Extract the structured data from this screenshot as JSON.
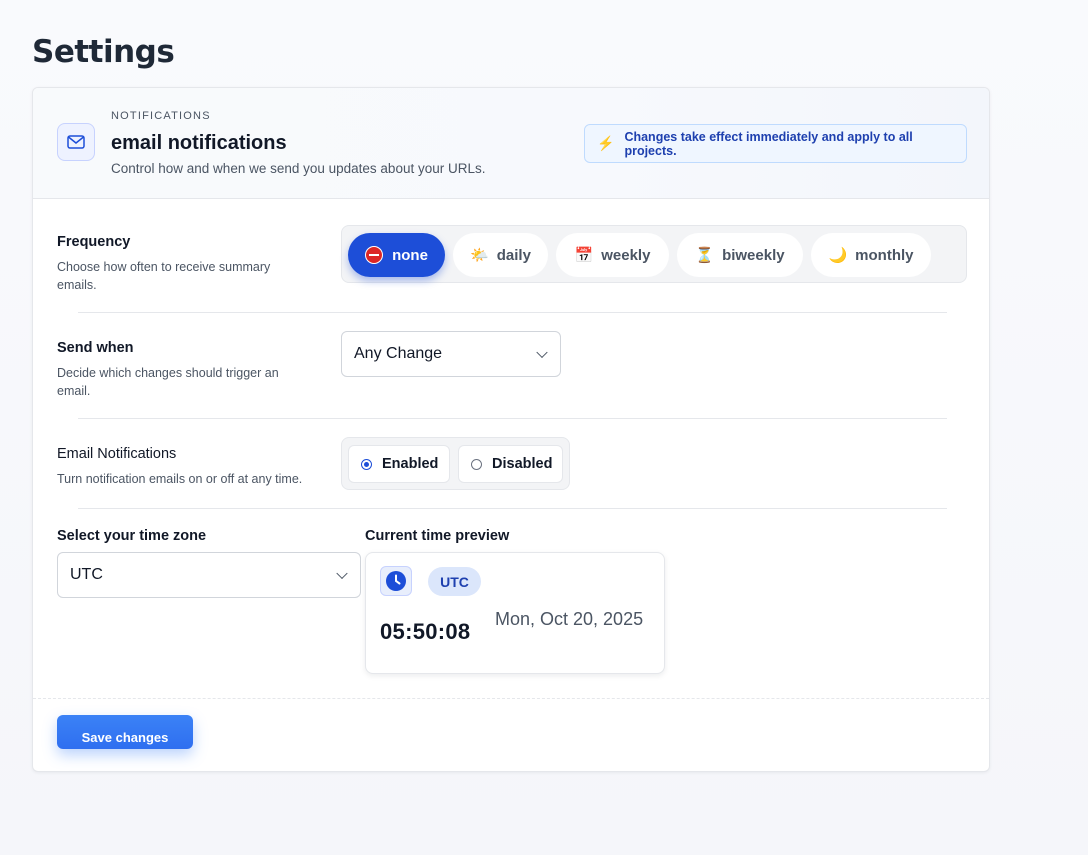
{
  "page": {
    "title": "Settings"
  },
  "header": {
    "eyebrow": "NOTIFICATIONS",
    "title": "email notifications",
    "subtitle": "Control how and when we send you updates about your URLs.",
    "icon": "mail-icon",
    "notice": "Changes take effect immediately and apply to all projects.",
    "notice_icon": "lightning-icon"
  },
  "frequency": {
    "label": "Frequency",
    "description": "Choose how often to receive summary emails.",
    "options": [
      {
        "label": "none",
        "icon": "no-entry-icon",
        "selected": true
      },
      {
        "label": "daily",
        "icon": "sun-behind-cloud-icon",
        "selected": false
      },
      {
        "label": "weekly",
        "icon": "calendar-icon",
        "selected": false
      },
      {
        "label": "biweekly",
        "icon": "hourglass-icon",
        "selected": false
      },
      {
        "label": "monthly",
        "icon": "crescent-moon-icon",
        "selected": false
      }
    ]
  },
  "send_when": {
    "label": "Send when",
    "description": "Decide which changes should trigger an email.",
    "selected": "Any Change"
  },
  "email_notifications": {
    "label": "Email Notifications",
    "description": "Turn notification emails on or off at any time.",
    "options": [
      {
        "label": "Enabled",
        "checked": true
      },
      {
        "label": "Disabled",
        "checked": false
      }
    ]
  },
  "timezone": {
    "label": "Select your time zone",
    "selected": "UTC"
  },
  "preview": {
    "label": "Current time preview",
    "badge": "UTC",
    "time": "05:50:08",
    "date": "Mon, Oct 20, 2025",
    "icon": "clock-icon"
  },
  "footer": {
    "save_label": "Save changes"
  },
  "colors": {
    "accent": "#1d4ed8",
    "button": "#3b82f6",
    "notice_bg": "#eff6ff",
    "notice_text": "#1e40af"
  }
}
